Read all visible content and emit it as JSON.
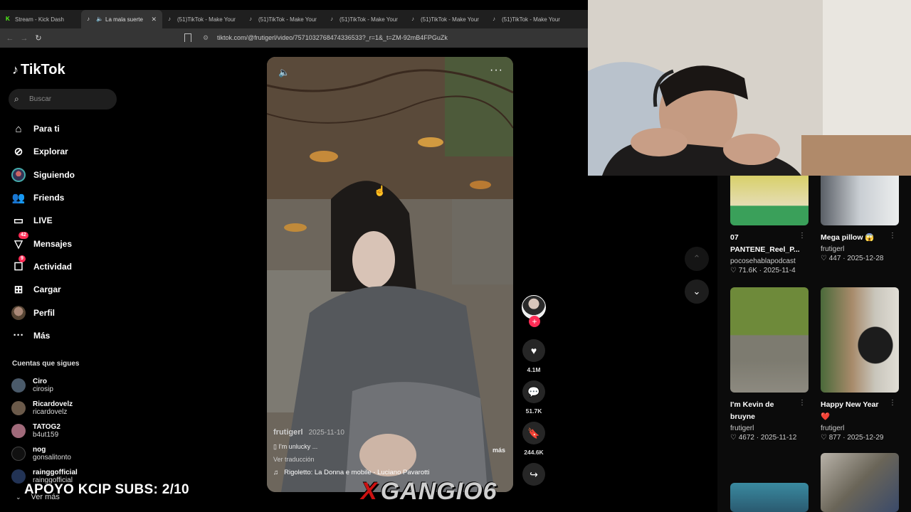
{
  "browser": {
    "tabs": [
      {
        "label": "Stream - Kick Dash",
        "active": false,
        "icon": "kick-icon"
      },
      {
        "label": "La mala suerte",
        "active": true,
        "icon": "tiktok-icon"
      },
      {
        "label": "(51)TikTok - Make Your",
        "active": false,
        "icon": "tiktok-icon"
      },
      {
        "label": "(51)TikTok - Make Your",
        "active": false,
        "icon": "tiktok-icon"
      },
      {
        "label": "(51)TikTok - Make Your",
        "active": false,
        "icon": "tiktok-icon"
      },
      {
        "label": "(51)TikTok - Make Your",
        "active": false,
        "icon": "tiktok-icon"
      },
      {
        "label": "(51)TikTok - Make Your",
        "active": false,
        "icon": "tiktok-icon"
      }
    ],
    "url": "tiktok.com/@frutigerl/video/7571032768474336533?_r=1&_t=ZM-92mB4FPGuZk"
  },
  "sidebar": {
    "logo": "TikTok",
    "search_placeholder": "Buscar",
    "nav": [
      {
        "label": "Para ti",
        "icon": "home-icon"
      },
      {
        "label": "Explorar",
        "icon": "compass-icon"
      },
      {
        "label": "Siguiendo",
        "icon": "following-avatar"
      },
      {
        "label": "Friends",
        "icon": "friends-icon"
      },
      {
        "label": "LIVE",
        "icon": "live-icon"
      },
      {
        "label": "Mensajes",
        "icon": "messages-icon",
        "badge": "42"
      },
      {
        "label": "Actividad",
        "icon": "activity-icon",
        "badge": "9"
      },
      {
        "label": "Cargar",
        "icon": "upload-icon"
      },
      {
        "label": "Perfil",
        "icon": "profile-avatar"
      },
      {
        "label": "Más",
        "icon": "more-icon"
      }
    ],
    "following_title": "Cuentas que sigues",
    "following": [
      {
        "name": "Ciro",
        "handle": "cirosip"
      },
      {
        "name": "Ricardovelz",
        "handle": "ricardovelz"
      },
      {
        "name": "TATOG2",
        "handle": "b4ut159"
      },
      {
        "name": "nog",
        "handle": "gonsalitonto"
      },
      {
        "name": "rainggofficial",
        "handle": "rainggofficial"
      }
    ],
    "see_more": "Ver más"
  },
  "video": {
    "author": "frutigerl",
    "date": "2025-11-10",
    "description": "I'm unlucky ...",
    "more": "más",
    "translate": "Ver traducción",
    "music": "Rigoletto: La Donna e mobile - Luciano Pavarotti"
  },
  "actions": {
    "likes": "4.1M",
    "comments": "51.7K",
    "saves": "244.6K"
  },
  "related": [
    {
      "title_lines": [
        "07",
        "PANTENE_Reel_P..."
      ],
      "user": "pocosehablapodcast",
      "likes": "71.6K",
      "date": "2025-11-4"
    },
    {
      "title_lines": [
        "Mega pillow 😱"
      ],
      "user": "frutigerl",
      "likes": "447",
      "date": "2025-12-28"
    },
    {
      "title_lines": [
        "I'm Kevin de",
        "bruyne"
      ],
      "user": "frutigerl",
      "likes": "4672",
      "date": "2025-11-12"
    },
    {
      "title_lines": [
        "Happy New Year",
        "❤️"
      ],
      "user": "frutigerl",
      "likes": "877",
      "date": "2025-12-29"
    }
  ],
  "overlays": {
    "subs_goal": "APOYO KCIP SUBS: 2/10",
    "watermark_x": "X",
    "watermark_text": "GANGIO6"
  },
  "colors": {
    "accent": "#fe2c55",
    "background": "#000000"
  }
}
